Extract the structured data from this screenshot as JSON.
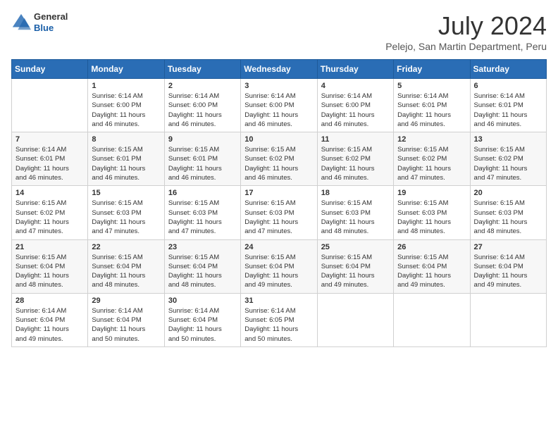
{
  "header": {
    "logo": {
      "general": "General",
      "blue": "Blue"
    },
    "title": "July 2024",
    "subtitle": "Pelejo, San Martin Department, Peru"
  },
  "calendar": {
    "days_of_week": [
      "Sunday",
      "Monday",
      "Tuesday",
      "Wednesday",
      "Thursday",
      "Friday",
      "Saturday"
    ],
    "weeks": [
      [
        {
          "day": "",
          "info": ""
        },
        {
          "day": "1",
          "info": "Sunrise: 6:14 AM\nSunset: 6:00 PM\nDaylight: 11 hours\nand 46 minutes."
        },
        {
          "day": "2",
          "info": "Sunrise: 6:14 AM\nSunset: 6:00 PM\nDaylight: 11 hours\nand 46 minutes."
        },
        {
          "day": "3",
          "info": "Sunrise: 6:14 AM\nSunset: 6:00 PM\nDaylight: 11 hours\nand 46 minutes."
        },
        {
          "day": "4",
          "info": "Sunrise: 6:14 AM\nSunset: 6:00 PM\nDaylight: 11 hours\nand 46 minutes."
        },
        {
          "day": "5",
          "info": "Sunrise: 6:14 AM\nSunset: 6:01 PM\nDaylight: 11 hours\nand 46 minutes."
        },
        {
          "day": "6",
          "info": "Sunrise: 6:14 AM\nSunset: 6:01 PM\nDaylight: 11 hours\nand 46 minutes."
        }
      ],
      [
        {
          "day": "7",
          "info": "Sunrise: 6:14 AM\nSunset: 6:01 PM\nDaylight: 11 hours\nand 46 minutes."
        },
        {
          "day": "8",
          "info": "Sunrise: 6:15 AM\nSunset: 6:01 PM\nDaylight: 11 hours\nand 46 minutes."
        },
        {
          "day": "9",
          "info": "Sunrise: 6:15 AM\nSunset: 6:01 PM\nDaylight: 11 hours\nand 46 minutes."
        },
        {
          "day": "10",
          "info": "Sunrise: 6:15 AM\nSunset: 6:02 PM\nDaylight: 11 hours\nand 46 minutes."
        },
        {
          "day": "11",
          "info": "Sunrise: 6:15 AM\nSunset: 6:02 PM\nDaylight: 11 hours\nand 46 minutes."
        },
        {
          "day": "12",
          "info": "Sunrise: 6:15 AM\nSunset: 6:02 PM\nDaylight: 11 hours\nand 47 minutes."
        },
        {
          "day": "13",
          "info": "Sunrise: 6:15 AM\nSunset: 6:02 PM\nDaylight: 11 hours\nand 47 minutes."
        }
      ],
      [
        {
          "day": "14",
          "info": "Sunrise: 6:15 AM\nSunset: 6:02 PM\nDaylight: 11 hours\nand 47 minutes."
        },
        {
          "day": "15",
          "info": "Sunrise: 6:15 AM\nSunset: 6:03 PM\nDaylight: 11 hours\nand 47 minutes."
        },
        {
          "day": "16",
          "info": "Sunrise: 6:15 AM\nSunset: 6:03 PM\nDaylight: 11 hours\nand 47 minutes."
        },
        {
          "day": "17",
          "info": "Sunrise: 6:15 AM\nSunset: 6:03 PM\nDaylight: 11 hours\nand 47 minutes."
        },
        {
          "day": "18",
          "info": "Sunrise: 6:15 AM\nSunset: 6:03 PM\nDaylight: 11 hours\nand 48 minutes."
        },
        {
          "day": "19",
          "info": "Sunrise: 6:15 AM\nSunset: 6:03 PM\nDaylight: 11 hours\nand 48 minutes."
        },
        {
          "day": "20",
          "info": "Sunrise: 6:15 AM\nSunset: 6:03 PM\nDaylight: 11 hours\nand 48 minutes."
        }
      ],
      [
        {
          "day": "21",
          "info": "Sunrise: 6:15 AM\nSunset: 6:04 PM\nDaylight: 11 hours\nand 48 minutes."
        },
        {
          "day": "22",
          "info": "Sunrise: 6:15 AM\nSunset: 6:04 PM\nDaylight: 11 hours\nand 48 minutes."
        },
        {
          "day": "23",
          "info": "Sunrise: 6:15 AM\nSunset: 6:04 PM\nDaylight: 11 hours\nand 48 minutes."
        },
        {
          "day": "24",
          "info": "Sunrise: 6:15 AM\nSunset: 6:04 PM\nDaylight: 11 hours\nand 49 minutes."
        },
        {
          "day": "25",
          "info": "Sunrise: 6:15 AM\nSunset: 6:04 PM\nDaylight: 11 hours\nand 49 minutes."
        },
        {
          "day": "26",
          "info": "Sunrise: 6:15 AM\nSunset: 6:04 PM\nDaylight: 11 hours\nand 49 minutes."
        },
        {
          "day": "27",
          "info": "Sunrise: 6:14 AM\nSunset: 6:04 PM\nDaylight: 11 hours\nand 49 minutes."
        }
      ],
      [
        {
          "day": "28",
          "info": "Sunrise: 6:14 AM\nSunset: 6:04 PM\nDaylight: 11 hours\nand 49 minutes."
        },
        {
          "day": "29",
          "info": "Sunrise: 6:14 AM\nSunset: 6:04 PM\nDaylight: 11 hours\nand 50 minutes."
        },
        {
          "day": "30",
          "info": "Sunrise: 6:14 AM\nSunset: 6:04 PM\nDaylight: 11 hours\nand 50 minutes."
        },
        {
          "day": "31",
          "info": "Sunrise: 6:14 AM\nSunset: 6:05 PM\nDaylight: 11 hours\nand 50 minutes."
        },
        {
          "day": "",
          "info": ""
        },
        {
          "day": "",
          "info": ""
        },
        {
          "day": "",
          "info": ""
        }
      ]
    ]
  }
}
